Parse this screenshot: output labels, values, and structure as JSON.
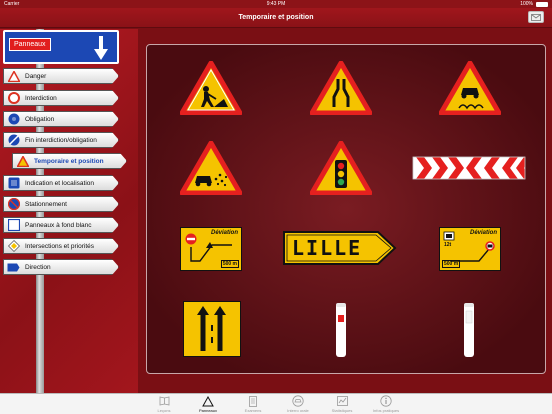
{
  "status": {
    "carrier": "Carrier",
    "time": "9:43 PM",
    "battery": "100%"
  },
  "nav": {
    "title": "Temporaire et position"
  },
  "sidebar": {
    "header_label": "Panneaux",
    "items": [
      {
        "label": "Danger",
        "icon": "danger-triangle-icon"
      },
      {
        "label": "Interdiction",
        "icon": "interdiction-circle-icon"
      },
      {
        "label": "Obligation",
        "icon": "obligation-circle-icon"
      },
      {
        "label": "Fin interdiction/obligation",
        "icon": "end-restriction-icon"
      },
      {
        "label": "Temporaire et position",
        "icon": "temporary-triangle-icon",
        "active": true
      },
      {
        "label": "Indication et localisation",
        "icon": "indication-square-icon"
      },
      {
        "label": "Stationnement",
        "icon": "parking-icon"
      },
      {
        "label": "Panneaux à fond blanc",
        "icon": "white-sign-icon"
      },
      {
        "label": "Intersections et priorités",
        "icon": "priority-diamond-icon"
      },
      {
        "label": "Direction",
        "icon": "direction-icon"
      }
    ]
  },
  "signs": {
    "deviation_1": "Déviation",
    "distance_1": "500 m",
    "lille": "LILLE",
    "deviation_2": "Déviation",
    "distance_2": "500 m",
    "width_limit": "12t"
  },
  "tabs": [
    {
      "label": "Leçons",
      "icon": "book-icon"
    },
    {
      "label": "Panneaux",
      "icon": "sign-triangle-icon",
      "active": true
    },
    {
      "label": "Examens",
      "icon": "exam-icon"
    },
    {
      "label": "Interro orale",
      "icon": "car-icon"
    },
    {
      "label": "Statistiques",
      "icon": "chart-icon"
    },
    {
      "label": "Infos pratiques",
      "icon": "info-icon"
    }
  ]
}
